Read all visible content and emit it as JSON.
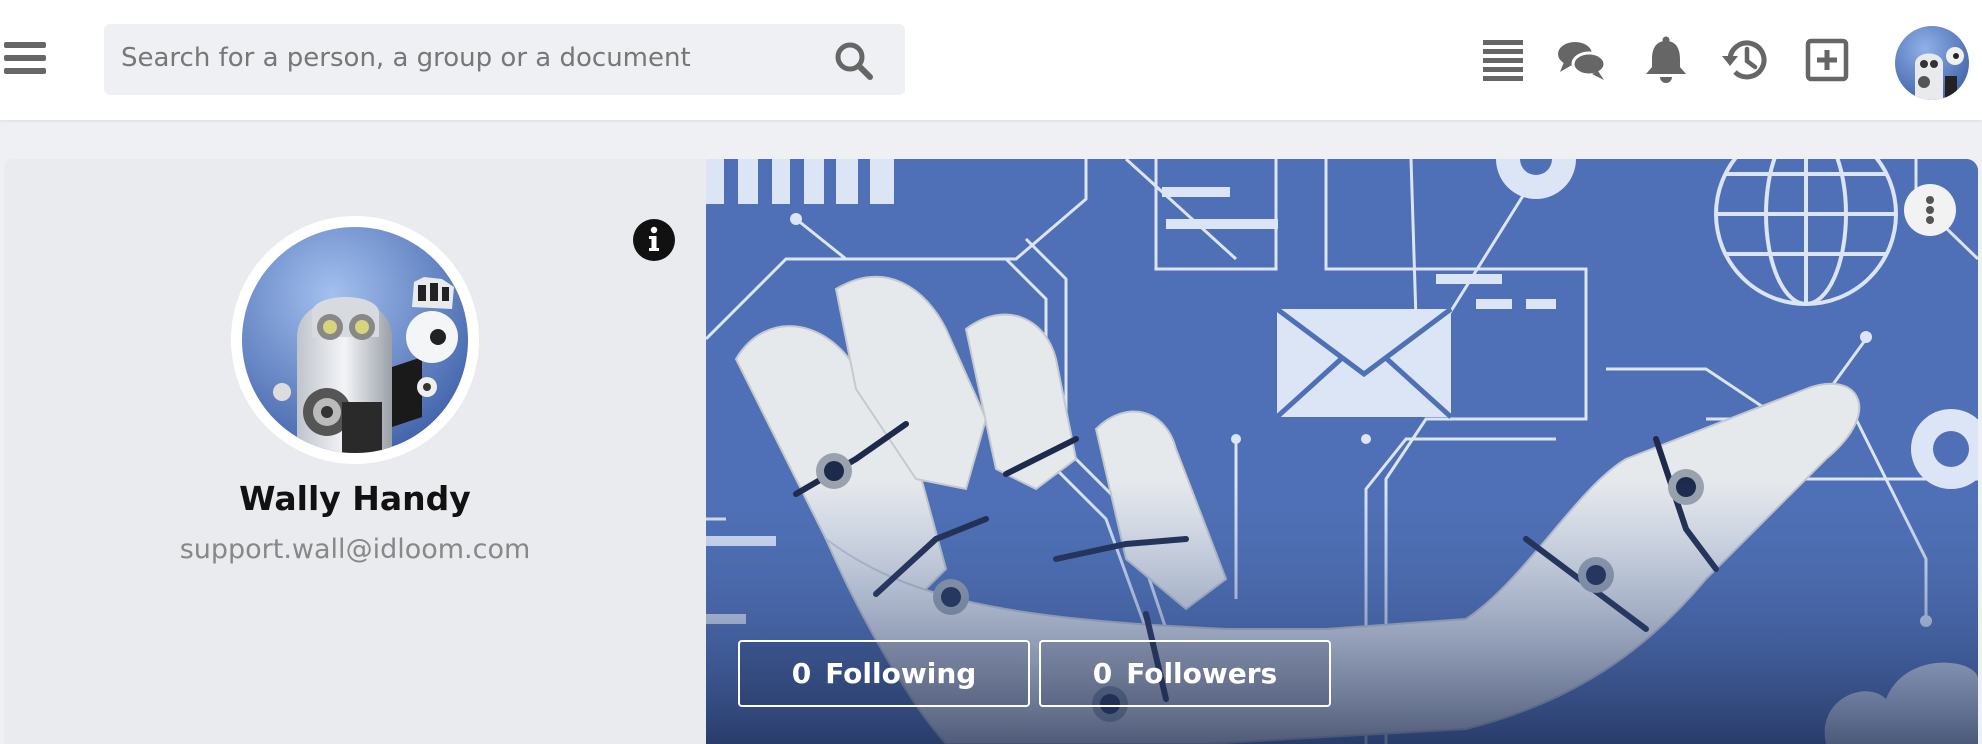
{
  "header": {
    "search": {
      "placeholder": "Search for a person, a group or a document"
    },
    "icons": [
      "menu-icon",
      "search-icon",
      "list-icon",
      "chat-icon",
      "bell-icon",
      "history-icon",
      "add-box-icon"
    ]
  },
  "profile": {
    "name": "Wally Handy",
    "email": "support.wall@idloom.com",
    "following": {
      "count": "0",
      "label": "Following"
    },
    "followers": {
      "count": "0",
      "label": "Followers"
    }
  },
  "colors": {
    "icon_gray": "#666666",
    "panel_bg": "#e9ebef",
    "cover_blue": "#4f70b6"
  }
}
